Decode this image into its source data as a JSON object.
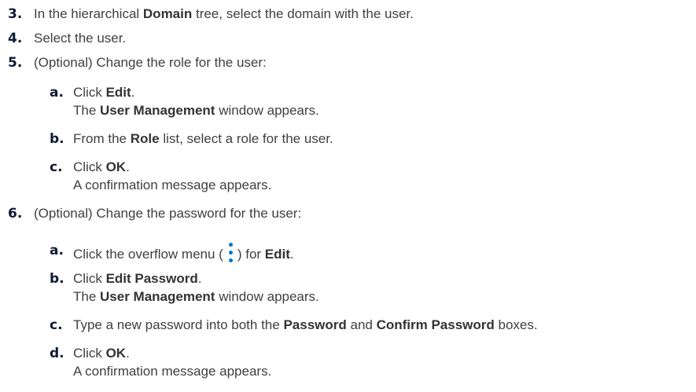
{
  "steps": [
    {
      "number": "3.",
      "pre": "In the hierarchical ",
      "bold": "Domain",
      "post": " tree, select the domain with the user."
    },
    {
      "number": "4.",
      "text": "Select the user."
    },
    {
      "number": "5.",
      "text": "(Optional) Change the role for the user:",
      "substeps": [
        {
          "letter": "a.",
          "pre": "Click ",
          "bold": "Edit",
          "post": ".",
          "result_pre": "The ",
          "result_bold": "User Management",
          "result_post": " window appears."
        },
        {
          "letter": "b.",
          "pre": "From the ",
          "bold": "Role",
          "post": " list, select a role for the user."
        },
        {
          "letter": "c.",
          "pre": "Click ",
          "bold": "OK",
          "post": ".",
          "result": "A confirmation message appears."
        }
      ]
    },
    {
      "number": "6.",
      "text": "(Optional) Change the password for the user:",
      "substeps": [
        {
          "letter": "a.",
          "pre": "Click the overflow menu (",
          "icon": "kebab-menu-icon",
          "mid": ") for ",
          "bold": "Edit",
          "post": "."
        },
        {
          "letter": "b.",
          "pre": "Click ",
          "bold": "Edit Password",
          "post": ".",
          "result_pre": "The ",
          "result_bold": "User Management",
          "result_post": " window appears."
        },
        {
          "letter": "c.",
          "pre": "Type a new password into both the ",
          "bold": "Password",
          "mid": " and ",
          "bold2": "Confirm Password",
          "post": " boxes."
        },
        {
          "letter": "d.",
          "pre": "Click ",
          "bold": "OK",
          "post": ".",
          "result": "A confirmation message appears."
        }
      ]
    }
  ],
  "colors": {
    "text": "#404040",
    "number": "#0d1a33",
    "icon": "#0076ce"
  }
}
